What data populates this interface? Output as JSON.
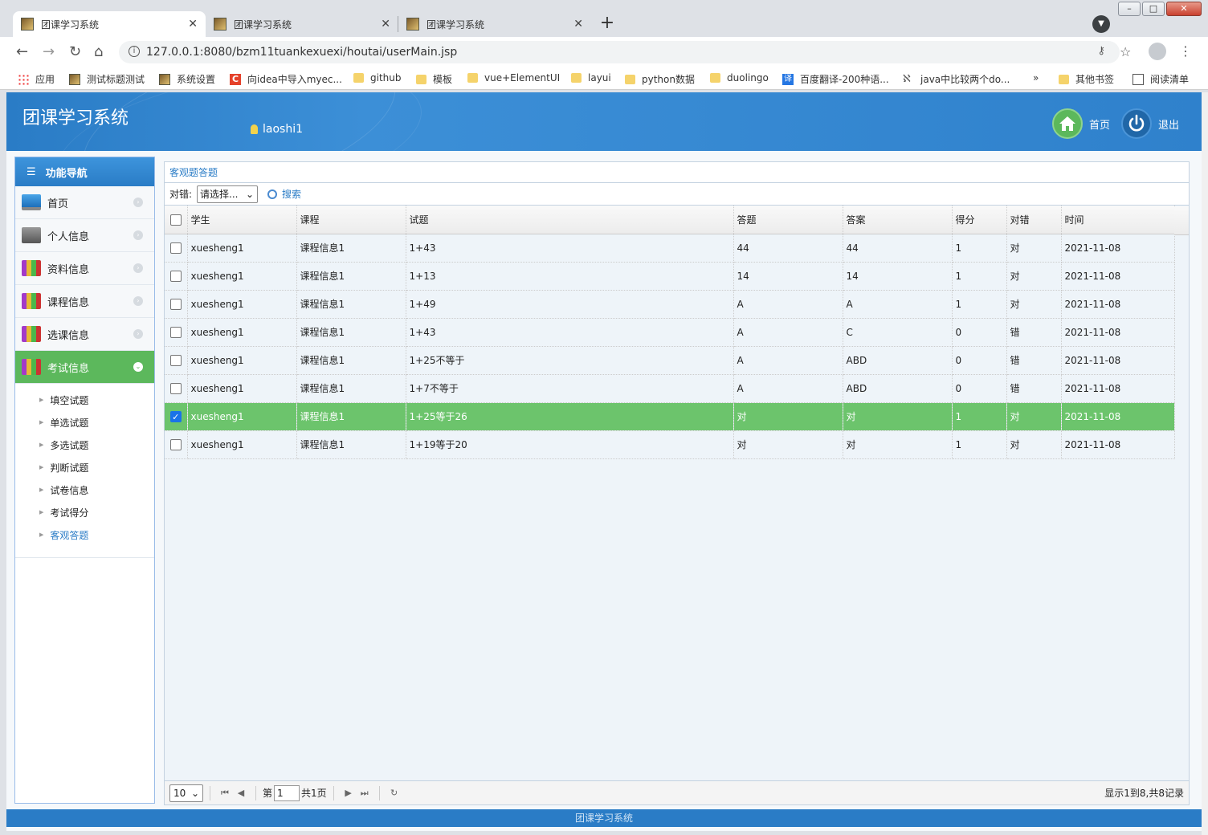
{
  "browser": {
    "tabs": [
      {
        "title": "团课学习系统",
        "close": "✕"
      },
      {
        "title": "团课学习系统",
        "close": "✕"
      },
      {
        "title": "团课学习系统",
        "close": "✕"
      }
    ],
    "new_tab": "+",
    "url": "127.0.0.1:8080/bzm11tuankexuexi/houtai/userMain.jsp",
    "bookmarks": [
      {
        "label": "应用",
        "icon": "apps-grid-icon"
      },
      {
        "label": "测试标题测试",
        "icon": "page-icon"
      },
      {
        "label": "系统设置",
        "icon": "page-icon"
      },
      {
        "label": "向idea中导入myec...",
        "icon": "csdn-icon"
      },
      {
        "label": "github",
        "icon": "folder-icon"
      },
      {
        "label": "模板",
        "icon": "folder-icon"
      },
      {
        "label": "vue+ElementUI",
        "icon": "folder-icon"
      },
      {
        "label": "layui",
        "icon": "folder-icon"
      },
      {
        "label": "python数据",
        "icon": "folder-icon"
      },
      {
        "label": "duolingo",
        "icon": "folder-icon"
      },
      {
        "label": "百度翻译-200种语...",
        "icon": "translate-icon"
      },
      {
        "label": "java中比较两个do...",
        "icon": "java-icon"
      }
    ],
    "bookmarks_more": "»",
    "other_bookmarks": "其他书签",
    "reading_list": "阅读清单"
  },
  "header": {
    "title": "团课学习系统",
    "user": "laoshi1",
    "home_label": "首页",
    "logout_label": "退出"
  },
  "sidebar": {
    "title": "功能导航",
    "items": [
      {
        "label": "首页",
        "icon": "monitor-icon"
      },
      {
        "label": "个人信息",
        "icon": "printer-icon"
      },
      {
        "label": "资料信息",
        "icon": "books-icon"
      },
      {
        "label": "课程信息",
        "icon": "books-icon"
      },
      {
        "label": "选课信息",
        "icon": "books-icon"
      },
      {
        "label": "考试信息",
        "icon": "books-icon"
      }
    ],
    "subitems": [
      "填空试题",
      "单选试题",
      "多选试题",
      "判断试题",
      "试卷信息",
      "考试得分",
      "客观答题"
    ]
  },
  "panel": {
    "title": "客观题答题",
    "filter_label": "对错:",
    "filter_select": "请选择...",
    "search_label": "搜索",
    "columns": [
      "学生",
      "课程",
      "试题",
      "答题",
      "答案",
      "得分",
      "对错",
      "时间"
    ],
    "rows": [
      {
        "checked": false,
        "cells": [
          "xuesheng1",
          "课程信息1",
          "1+43",
          "44",
          "44",
          "1",
          "对",
          "2021-11-08"
        ]
      },
      {
        "checked": false,
        "cells": [
          "xuesheng1",
          "课程信息1",
          "1+13",
          "14",
          "14",
          "1",
          "对",
          "2021-11-08"
        ]
      },
      {
        "checked": false,
        "cells": [
          "xuesheng1",
          "课程信息1",
          "1+49",
          "A",
          "A",
          "1",
          "对",
          "2021-11-08"
        ]
      },
      {
        "checked": false,
        "cells": [
          "xuesheng1",
          "课程信息1",
          "1+43",
          "A",
          "C",
          "0",
          "错",
          "2021-11-08"
        ]
      },
      {
        "checked": false,
        "cells": [
          "xuesheng1",
          "课程信息1",
          "1+25不等于",
          "A",
          "ABD",
          "0",
          "错",
          "2021-11-08"
        ]
      },
      {
        "checked": false,
        "cells": [
          "xuesheng1",
          "课程信息1",
          "1+7不等于",
          "A",
          "ABD",
          "0",
          "错",
          "2021-11-08"
        ]
      },
      {
        "checked": true,
        "cells": [
          "xuesheng1",
          "课程信息1",
          "1+25等于26",
          "对",
          "对",
          "1",
          "对",
          "2021-11-08"
        ]
      },
      {
        "checked": false,
        "cells": [
          "xuesheng1",
          "课程信息1",
          "1+19等于20",
          "对",
          "对",
          "1",
          "对",
          "2021-11-08"
        ]
      }
    ],
    "pager": {
      "page_size": "10",
      "page_prefix": "第",
      "page_value": "1",
      "page_total": "共1页",
      "info": "显示1到8,共8记录"
    }
  },
  "footer": {
    "text": "团课学习系统"
  },
  "colors": {
    "brand": "#2a7cc6",
    "selected_row": "#6cc46c",
    "active_menu": "#5cb85c"
  }
}
